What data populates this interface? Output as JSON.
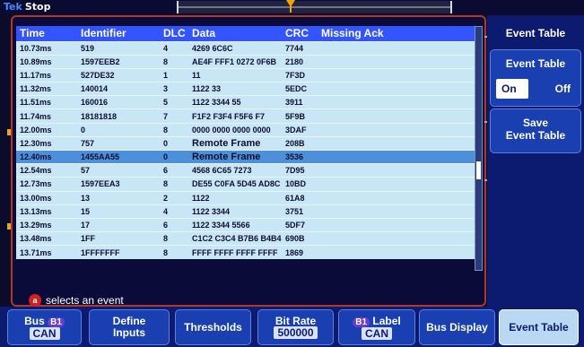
{
  "status": {
    "logo_brand": "Tek",
    "state": "Stop"
  },
  "table": {
    "headers": [
      "Time",
      "Identifier",
      "DLC",
      "Data",
      "CRC",
      "Missing Ack"
    ],
    "rows": [
      [
        "10.73ms",
        "519",
        "4",
        "4269 6C6C",
        "7744",
        ""
      ],
      [
        "10.89ms",
        "1597EEB2",
        "8",
        "AE4F FFF1 0272 0F6B",
        "2180",
        ""
      ],
      [
        "11.17ms",
        "527DE32",
        "1",
        "11",
        "7F3D",
        ""
      ],
      [
        "11.32ms",
        "140014",
        "3",
        "1122 33",
        "5EDC",
        ""
      ],
      [
        "11.51ms",
        "160016",
        "5",
        "1122 3344 55",
        "3911",
        ""
      ],
      [
        "11.74ms",
        "18181818",
        "7",
        "F1F2 F3F4 F5F6 F7",
        "5F9B",
        ""
      ],
      [
        "12.00ms",
        "0",
        "8",
        "0000 0000 0000 0000",
        "3DAF",
        ""
      ],
      [
        "12.30ms",
        "757",
        "0",
        "Remote Frame",
        "208B",
        ""
      ],
      [
        "12.40ms",
        "1455AA55",
        "0",
        "Remote Frame",
        "3536",
        ""
      ],
      [
        "12.54ms",
        "57",
        "6",
        "4568 6C65 7273",
        "7D95",
        ""
      ],
      [
        "12.73ms",
        "1597EEA3",
        "8",
        "DE55 C0FA 5D45 AD8C",
        "10BD",
        ""
      ],
      [
        "13.00ms",
        "13",
        "2",
        "1122",
        "61A8",
        ""
      ],
      [
        "13.13ms",
        "15",
        "4",
        "1122 3344",
        "3751",
        ""
      ],
      [
        "13.29ms",
        "17",
        "6",
        "1122 3344 5566",
        "5DF7",
        ""
      ],
      [
        "13.48ms",
        "1FF",
        "8",
        "C1C2 C3C4 B7B6 B4B4",
        "690B",
        ""
      ],
      [
        "13.71ms",
        "1FFFFFFF",
        "8",
        "FFFF FFFF FFFF FFFF",
        "1869",
        ""
      ]
    ],
    "selected_index": 8,
    "hint_icon": "a",
    "hint_text": "selects an event"
  },
  "side_menu": {
    "title": "Event Table",
    "toggle_label": "Event Table",
    "toggle_on": "On",
    "toggle_off": "Off",
    "save_line1": "Save",
    "save_line2": "Event Table"
  },
  "bottom_menu": {
    "bus_label": "Bus",
    "bus_badge": "B1",
    "bus_value": "CAN",
    "define_line1": "Define",
    "define_line2": "Inputs",
    "thresholds": "Thresholds",
    "bitrate_label": "Bit Rate",
    "bitrate_value": "500000",
    "label_badge": "B1",
    "label_label": "Label",
    "label_value": "CAN",
    "bus_display": "Bus Display",
    "event_table": "Event Table"
  },
  "colors": {
    "table_row": "#c8e6f5",
    "selected_row": "#4d8fda",
    "header": "#3355ff",
    "frame": "#b03828",
    "trigger": "#f3a400"
  }
}
